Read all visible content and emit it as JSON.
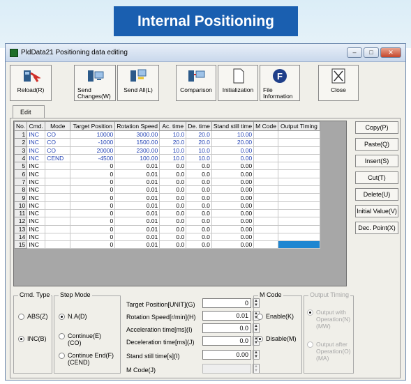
{
  "banner": {
    "title": "Internal Positioning"
  },
  "window": {
    "title": "PldData21  Positioning data editing"
  },
  "toolbar": {
    "reload": "Reload(R)",
    "send_changes": "Send\nChanges(W)",
    "send_all": "Send All(L)",
    "comparison": "Comparison",
    "initialization": "Initialization",
    "file_information": "File\nInformation",
    "close": "Close"
  },
  "tab": {
    "edit": "Edit"
  },
  "table": {
    "headers": [
      "No.",
      "Cmd.",
      "Mode",
      "Target Position",
      "Rotation Speed",
      "Ac. time",
      "De. time",
      "Stand still time",
      "M Code",
      "Output Timing"
    ],
    "rows": [
      [
        "1",
        "INC",
        "CO",
        "10000",
        "3000.00",
        "10.0",
        "20.0",
        "10.00",
        "",
        ""
      ],
      [
        "2",
        "INC",
        "CO",
        "-1000",
        "1500.00",
        "20.0",
        "20.0",
        "20.00",
        "",
        ""
      ],
      [
        "3",
        "INC",
        "CO",
        "20000",
        "2300.00",
        "10.0",
        "10.0",
        "0.00",
        "",
        ""
      ],
      [
        "4",
        "INC",
        "CEND",
        "-4500",
        "100.00",
        "10.0",
        "10.0",
        "0.00",
        "",
        ""
      ],
      [
        "5",
        "INC",
        "",
        "0",
        "0.01",
        "0.0",
        "0.0",
        "0.00",
        "",
        ""
      ],
      [
        "6",
        "INC",
        "",
        "0",
        "0.01",
        "0.0",
        "0.0",
        "0.00",
        "",
        ""
      ],
      [
        "7",
        "INC",
        "",
        "0",
        "0.01",
        "0.0",
        "0.0",
        "0.00",
        "",
        ""
      ],
      [
        "8",
        "INC",
        "",
        "0",
        "0.01",
        "0.0",
        "0.0",
        "0.00",
        "",
        ""
      ],
      [
        "9",
        "INC",
        "",
        "0",
        "0.01",
        "0.0",
        "0.0",
        "0.00",
        "",
        ""
      ],
      [
        "10",
        "INC",
        "",
        "0",
        "0.01",
        "0.0",
        "0.0",
        "0.00",
        "",
        ""
      ],
      [
        "11",
        "INC",
        "",
        "0",
        "0.01",
        "0.0",
        "0.0",
        "0.00",
        "",
        ""
      ],
      [
        "12",
        "INC",
        "",
        "0",
        "0.01",
        "0.0",
        "0.0",
        "0.00",
        "",
        ""
      ],
      [
        "13",
        "INC",
        "",
        "0",
        "0.01",
        "0.0",
        "0.0",
        "0.00",
        "",
        ""
      ],
      [
        "14",
        "INC",
        "",
        "0",
        "0.01",
        "0.0",
        "0.0",
        "0.00",
        "",
        ""
      ],
      [
        "15",
        "INC",
        "",
        "0",
        "0.01",
        "0.0",
        "0.0",
        "0.00",
        "",
        ""
      ]
    ]
  },
  "side_buttons": [
    "Copy(P)",
    "Paste(Q)",
    "Insert(S)",
    "Cut(T)",
    "Delete(U)",
    "Initial Value(V)",
    "Dec. Point(X)"
  ],
  "cmd_type": {
    "title": "Cmd. Type",
    "abs": "ABS(Z)",
    "inc": "INC(B)"
  },
  "step_mode": {
    "title": "Step Mode",
    "na": "N.A(D)",
    "continue": "Continue(E)\n(CO)",
    "continue_end": "Continue End(F)\n(CEND)"
  },
  "fields": {
    "target_position": {
      "label": "Target Position[UNIT](G)",
      "value": "0"
    },
    "rotation_speed": {
      "label": "Rotation Speed[r/min](H)",
      "value": "0.01"
    },
    "acceleration": {
      "label": "Acceleration time[ms](I)",
      "value": "0.0"
    },
    "deceleration": {
      "label": "Deceleration time[ms](J)",
      "value": "0.0"
    },
    "stand_still": {
      "label": "Stand still time[s](I)",
      "value": "0.00"
    },
    "m_code": {
      "label": "M Code(J)",
      "value": ""
    }
  },
  "m_code_group": {
    "title": "M Code",
    "enable": "Enable(K)",
    "disable": "Disable(M)"
  },
  "output_timing": {
    "title": "Output Timing",
    "with": "Output with\nOperation(N)\n(MW)",
    "after": "Output after\nOperation(O)\n(MA)"
  }
}
